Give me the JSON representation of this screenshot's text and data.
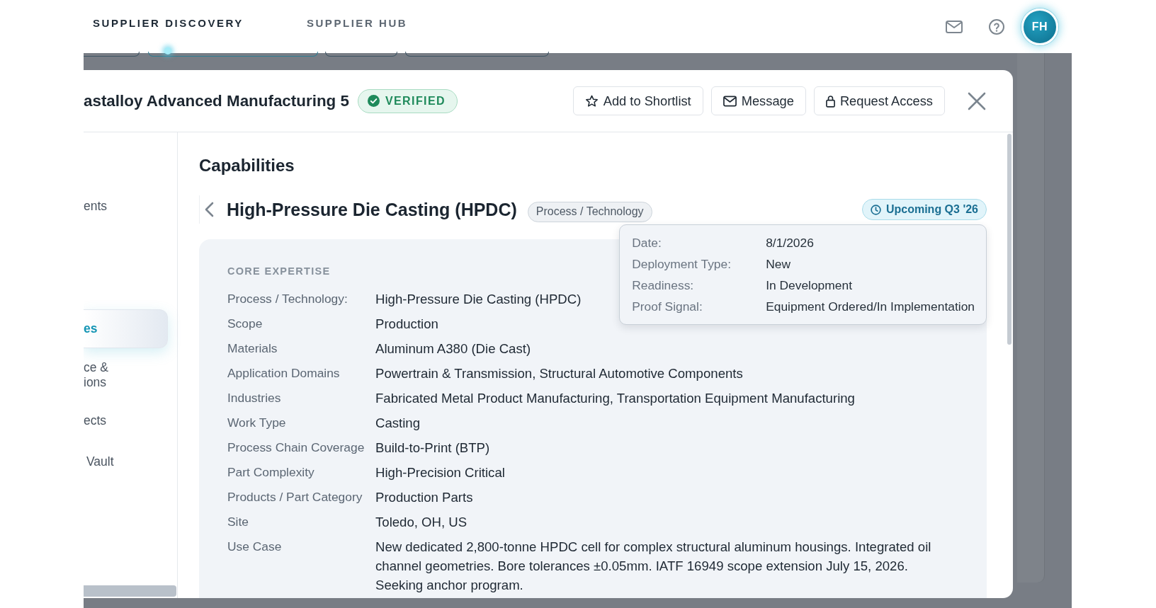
{
  "top_nav": {
    "tabs": [
      {
        "label": "SUPPLIER DISCOVERY",
        "selected": true
      },
      {
        "label": "SUPPLIER HUB",
        "selected": false
      }
    ],
    "avatar_initials": "FH"
  },
  "modal": {
    "title": "astalloy Advanced Manufacturing 5",
    "verified_badge": "VERIFIED",
    "actions": [
      {
        "kind": "shortlist",
        "label": "Add to Shortlist"
      },
      {
        "kind": "message",
        "label": "Message"
      },
      {
        "kind": "access",
        "label": "Request Access"
      }
    ]
  },
  "sidebar": {
    "items": [
      {
        "label": "ents",
        "selected": false
      },
      {
        "label": "es",
        "selected": true
      },
      {
        "label": "ce &\nions",
        "selected": false
      },
      {
        "label": "ects",
        "selected": false
      },
      {
        "label": "Vault",
        "selected": false
      }
    ]
  },
  "content": {
    "section_title": "Capabilities",
    "capability": {
      "title": "High-Pressure Die Casting (HPDC)",
      "tag": "Process / Technology",
      "status_badge": "Upcoming Q3 '26",
      "tooltip": [
        {
          "label": "Date:",
          "value": "8/1/2026"
        },
        {
          "label": "Deployment Type:",
          "value": "New"
        },
        {
          "label": "Readiness:",
          "value": "In Development"
        },
        {
          "label": "Proof Signal:",
          "value": "Equipment Ordered/In Implementation"
        }
      ],
      "group_title": "CORE EXPERTISE",
      "fields": [
        {
          "label": "Process / Technology:",
          "value": "High-Pressure Die Casting (HPDC)"
        },
        {
          "label": "Scope",
          "value": "Production"
        },
        {
          "label": "Materials",
          "value": "Aluminum A380 (Die Cast)"
        },
        {
          "label": "Application Domains",
          "value": "Powertrain & Transmission, Structural Automotive Components"
        },
        {
          "label": "Industries",
          "value": "Fabricated Metal Product Manufacturing, Transportation Equipment Manufacturing"
        },
        {
          "label": "Work Type",
          "value": "Casting"
        },
        {
          "label": "Process Chain Coverage",
          "value": "Build-to-Print (BTP)"
        },
        {
          "label": "Part Complexity",
          "value": "High-Precision Critical"
        },
        {
          "label": "Products / Part Category",
          "value": "Production Parts"
        },
        {
          "label": "Site",
          "value": "Toledo, OH, US"
        },
        {
          "label": "Use Case",
          "value": "New dedicated 2,800-tonne HPDC cell for complex structural aluminum housings. Integrated oil channel geometries. Bore tolerances ±0.05mm. IATF 16949 scope extension July 15, 2026. Seeking anchor program."
        }
      ]
    }
  }
}
